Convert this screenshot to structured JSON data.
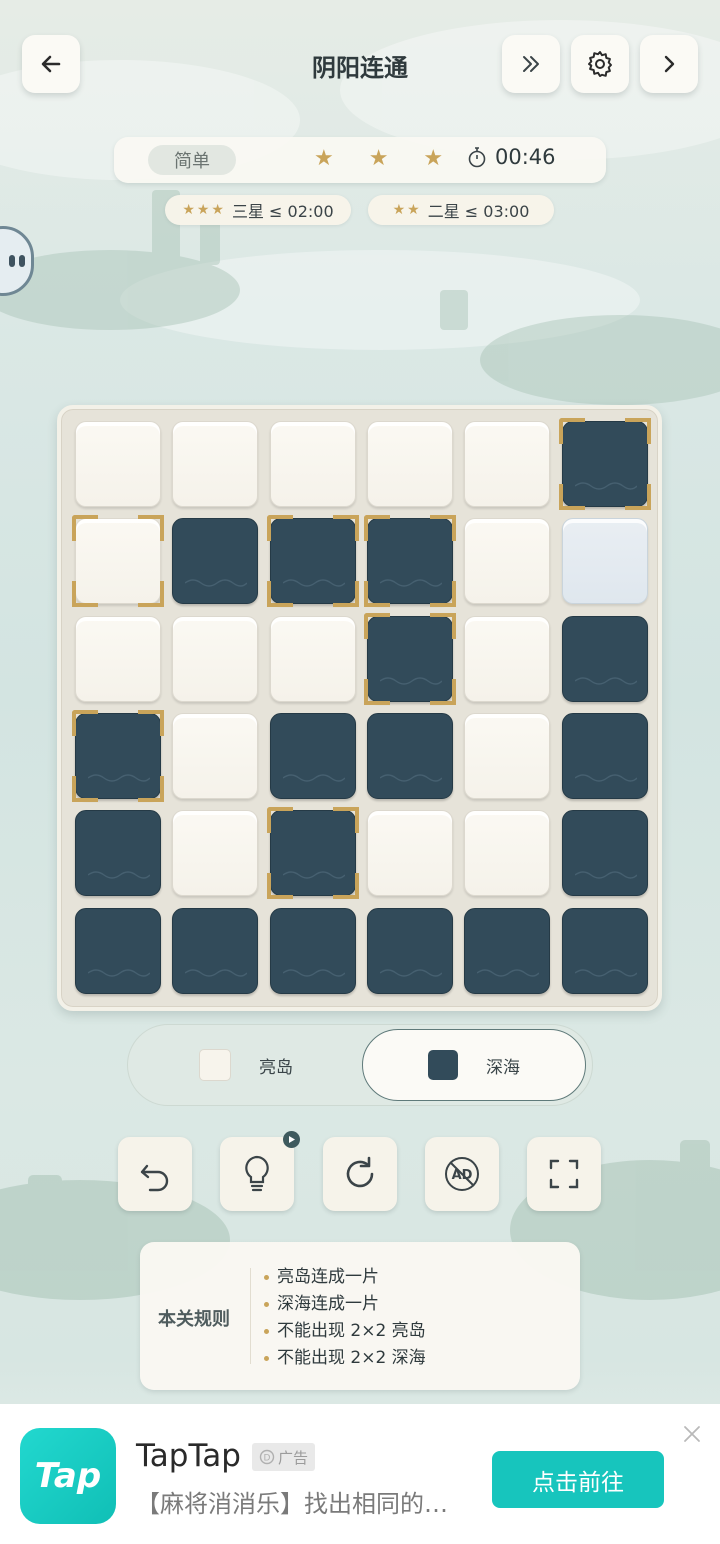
{
  "header": {
    "title": "阴阳连通",
    "back_icon": "arrow-left-icon",
    "skip_icon": "double-chevron-right-icon",
    "settings_icon": "gear-icon",
    "next_icon": "chevron-right-icon"
  },
  "status": {
    "difficulty": "简单",
    "stars": "★ ★ ★",
    "timer": "00:46"
  },
  "goals": [
    {
      "stars": "★★★",
      "label": "三星 ≤ 02:00"
    },
    {
      "stars": "★★",
      "label": "二星 ≤ 03:00"
    }
  ],
  "board": {
    "rows": 6,
    "cols": 6,
    "cells": [
      [
        "light",
        "light",
        "light",
        "light",
        "light",
        "dark"
      ],
      [
        "light",
        "dark",
        "dark",
        "dark",
        "light",
        "empty"
      ],
      [
        "light",
        "light",
        "light",
        "dark",
        "light",
        "dark"
      ],
      [
        "dark",
        "light",
        "dark",
        "dark",
        "light",
        "dark"
      ],
      [
        "dark",
        "light",
        "dark",
        "light",
        "light",
        "dark"
      ],
      [
        "dark",
        "dark",
        "dark",
        "dark",
        "dark",
        "dark"
      ]
    ],
    "fixed": [
      [
        0,
        5
      ],
      [
        1,
        0
      ],
      [
        1,
        2
      ],
      [
        1,
        3
      ],
      [
        2,
        3
      ],
      [
        3,
        0
      ],
      [
        4,
        2
      ]
    ]
  },
  "toggle": {
    "light_label": "亮岛",
    "dark_label": "深海",
    "selected": "深海"
  },
  "tools": [
    {
      "name": "undo-button",
      "icon": "undo-icon"
    },
    {
      "name": "hint-button",
      "icon": "lightbulb-icon",
      "badge": "play-icon"
    },
    {
      "name": "restart-button",
      "icon": "restart-icon"
    },
    {
      "name": "no-ads-button",
      "icon": "no-ads-icon",
      "text": "AD"
    },
    {
      "name": "fullscreen-button",
      "icon": "fullscreen-icon"
    }
  ],
  "rules": {
    "title": "本关规则",
    "items": [
      "亮岛连成一片",
      "深海连成一片",
      "不能出现 2×2 亮岛",
      "不能出现 2×2 深海"
    ]
  },
  "ad": {
    "logo_text": "Tap",
    "app_name": "TapTap",
    "tag": "广告",
    "description": "【麻将消消乐】找出相同的麻将牌",
    "cta": "点击前往"
  },
  "colors": {
    "dark_cell": "#324b5a",
    "light_cell": "#f7f4ec",
    "gold": "#c9a45a",
    "cta": "#17c5bd"
  }
}
